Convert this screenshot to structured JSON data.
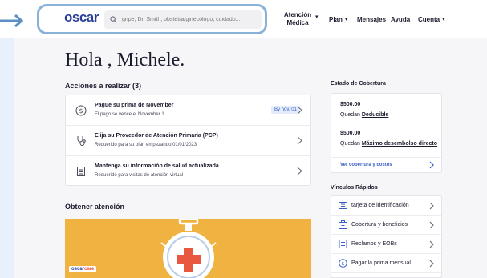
{
  "header": {
    "logo": "oscar",
    "search_placeholder": "gripe, Dr. Smith, obstetra/ginecólogo, cuidado...",
    "nav": {
      "atencion_line1": "Atención",
      "atencion_line2": "Médica",
      "plan": "Plan",
      "mensajes": "Mensajes",
      "ayuda": "Ayuda",
      "cuenta": "Cuenta"
    }
  },
  "greeting": "Hola , Michele.",
  "acciones": {
    "title": "Acciones a realizar (3)",
    "items": [
      {
        "title": "Pague su prima de November",
        "subtitle": "El pago se vence el November 1",
        "badge": "By nov. 01",
        "icon": "dollar-icon"
      },
      {
        "title": "Elija su Proveedor de Atención Primaria (PCP)",
        "subtitle": "Requerido para su plan empezando 01/01/2023",
        "icon": "stethoscope-icon"
      },
      {
        "title": "Mantenga su información de salud actualizada",
        "subtitle": "Requerido para visitas de atención virtual",
        "icon": "document-icon"
      }
    ]
  },
  "obtener": {
    "title": "Obtener atención",
    "brand_prefix": "oscar",
    "brand_suffix": "care"
  },
  "cobertura": {
    "title": "Estado de Cobertura",
    "deducible_amount": "$500.00",
    "deducible_prefix": "Quedan",
    "deducible_label": "Deducible",
    "maximo_amount": "$500.00",
    "maximo_prefix": "Quedan",
    "maximo_label": "Máximo desembolso directo",
    "link": "Ver cobertura y costos"
  },
  "vinculos": {
    "title": "Vínculos Rápidos",
    "items": [
      {
        "label": "tarjeta de identificación",
        "icon": "id-card-icon"
      },
      {
        "label": "Cobertura y beneficios",
        "icon": "medical-kit-icon"
      },
      {
        "label": "Reclamos y EOBs",
        "icon": "receipt-icon"
      },
      {
        "label": "Pagar la prima mensual",
        "icon": "dollar-icon"
      }
    ]
  },
  "colors": {
    "brand": "#2a3d9a",
    "link": "#3a5fc4",
    "banner": "#f0b341",
    "highlight": "#8ab2d8"
  }
}
